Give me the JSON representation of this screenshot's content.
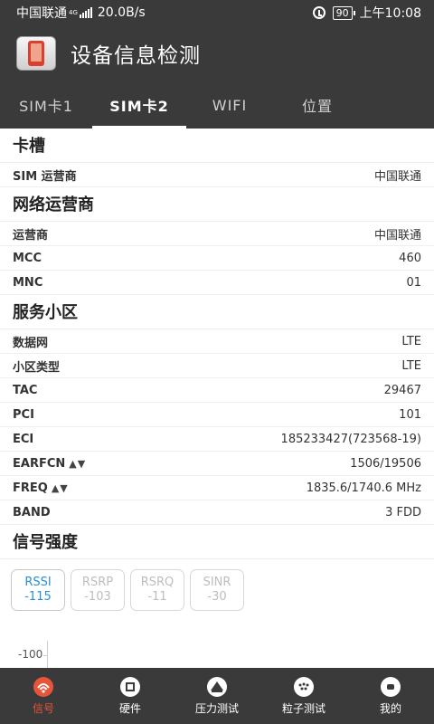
{
  "status_bar": {
    "carrier": "中国联通",
    "net_type": "4G",
    "speed": "20.0B/s",
    "battery": "90",
    "time": "上午10:08"
  },
  "app_bar": {
    "title": "设备信息检测"
  },
  "tabs": [
    {
      "label": "SIM卡1",
      "active": false
    },
    {
      "label": "SIM卡2",
      "active": true
    },
    {
      "label": "WIFI",
      "active": false
    },
    {
      "label": "位置",
      "active": false
    }
  ],
  "sections": {
    "slot": {
      "title": "卡槽",
      "rows": [
        {
          "key": "SIM 运营商",
          "value": "中国联通"
        }
      ]
    },
    "network": {
      "title": "网络运营商",
      "rows": [
        {
          "key": "运营商",
          "value": "中国联通"
        },
        {
          "key": "MCC",
          "value": "460"
        },
        {
          "key": "MNC",
          "value": "01"
        }
      ]
    },
    "cell": {
      "title": "服务小区",
      "rows": [
        {
          "key": "数据网",
          "value": "LTE"
        },
        {
          "key": "小区类型",
          "value": "LTE"
        },
        {
          "key": "TAC",
          "value": "29467"
        },
        {
          "key": "PCI",
          "value": "101"
        },
        {
          "key": "ECI",
          "value": "185233427(723568-19)"
        },
        {
          "key": "EARFCN",
          "value": "1506/19506",
          "arrows": "▲▼"
        },
        {
          "key": "FREQ",
          "value": "1835.6/1740.6 MHz",
          "arrows": "▲▼"
        },
        {
          "key": "BAND",
          "value": "3 FDD"
        }
      ]
    },
    "signal": {
      "title": "信号强度",
      "buttons": [
        {
          "label": "RSSI",
          "value": "-115",
          "active": true
        },
        {
          "label": "RSRP",
          "value": "-103",
          "active": false
        },
        {
          "label": "RSRQ",
          "value": "-11",
          "active": false
        },
        {
          "label": "SINR",
          "value": "-30",
          "active": false
        }
      ],
      "chart_y_label": "-100"
    }
  },
  "bottom_nav": [
    {
      "label": "信号",
      "icon": "signal-icon",
      "active": true
    },
    {
      "label": "硬件",
      "icon": "hardware-icon",
      "active": false
    },
    {
      "label": "压力测试",
      "icon": "stress-test-icon",
      "active": false
    },
    {
      "label": "粒子测试",
      "icon": "particle-test-icon",
      "active": false
    },
    {
      "label": "我的",
      "icon": "profile-icon",
      "active": false
    }
  ],
  "colors": {
    "bar_bg": "#3a3a3a",
    "accent_blue": "#2b8fd4",
    "accent_red": "#e6543a"
  }
}
